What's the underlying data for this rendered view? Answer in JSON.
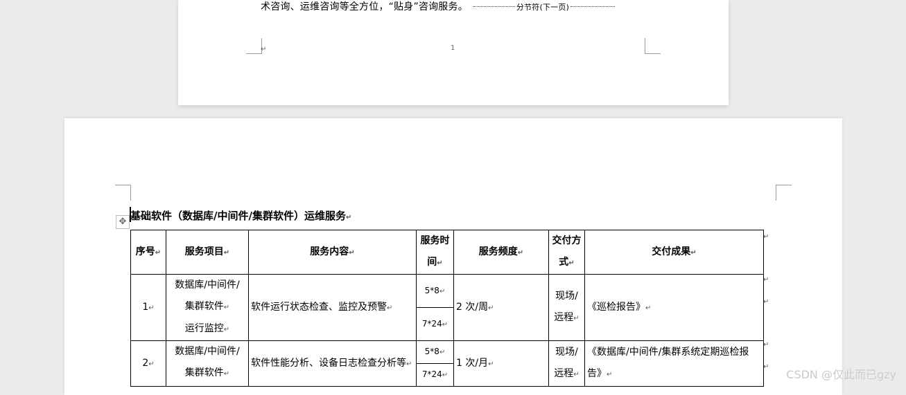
{
  "page1": {
    "text": "术咨询、运维咨询等全方位，“贴身”咨询服务。",
    "section_break": "分节符(下一页)",
    "page_number": "1",
    "mark": "↵"
  },
  "page2": {
    "heading": "基础软件（数据库/中间件/集群软件）运维服务",
    "mark": "↵",
    "move_icon": "move-icon",
    "table": {
      "headers": [
        "序号",
        "服务项目",
        "服务内容",
        "服务时间",
        "服务频度",
        "交付方式",
        "交付成果"
      ],
      "rows": [
        {
          "no": "1",
          "item": [
            "数据库/中间件/",
            "集群软件",
            "运行监控"
          ],
          "content": "软件运行状态检查、监控及预警",
          "time": [
            "5*8",
            "7*24"
          ],
          "freq": "2 次/周",
          "mode": [
            "现场/",
            "远程"
          ],
          "result": "《巡检报告》"
        },
        {
          "no": "2",
          "item": [
            "数据库/中间件/",
            "集群软件"
          ],
          "content": "软件性能分析、设备日志检查分析等",
          "time": [
            "5*8",
            "7*24"
          ],
          "freq": "1 次/月",
          "mode": [
            "现场/",
            "远程"
          ],
          "result": "《数据库/中间件/集群系统定期巡检报告》"
        }
      ]
    }
  },
  "watermark": "CSDN @仅此而已gzy",
  "colors": {
    "background": "#eaebec",
    "page": "#ffffff",
    "crop_marks": "#9a9a9a"
  }
}
